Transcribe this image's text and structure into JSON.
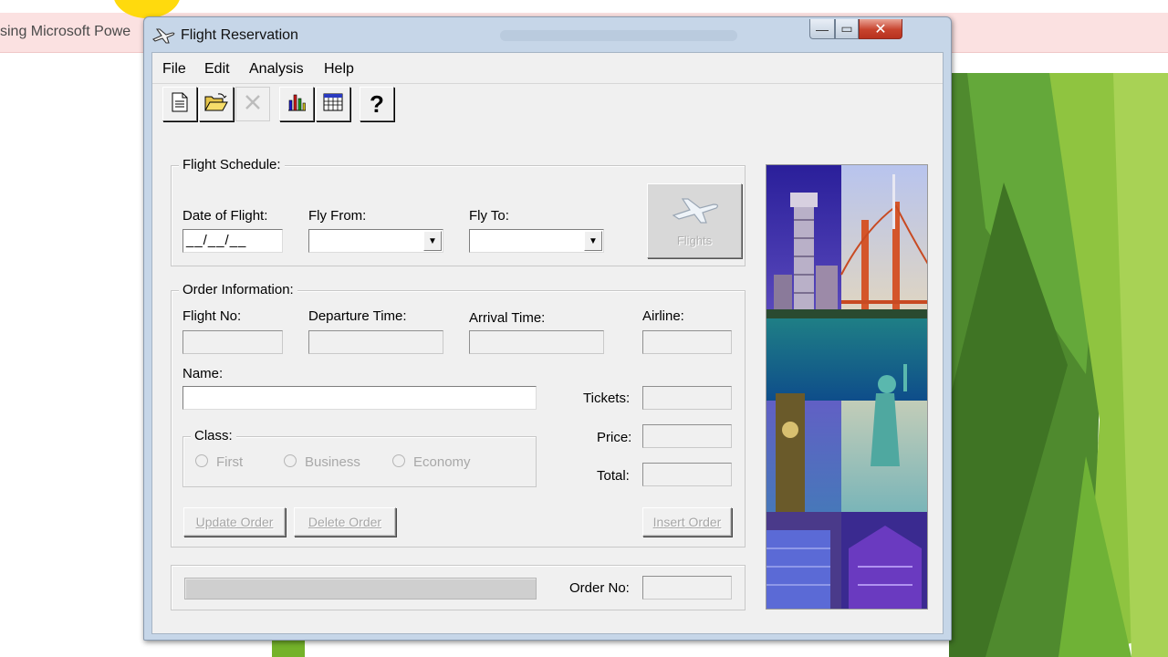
{
  "background": {
    "window_title": "sing Microsoft Powe",
    "colors": {
      "accent_green": "#74b22a",
      "cursor_highlight": "#ffd800",
      "titlebar_pink": "#fbe1e1"
    }
  },
  "window": {
    "title": "Flight Reservation",
    "buttons": {
      "minimize": "—",
      "maximize": "▭",
      "close": "✕"
    }
  },
  "menu": {
    "items": [
      "File",
      "Edit",
      "Analysis",
      "Help"
    ]
  },
  "toolbar": {
    "buttons": [
      {
        "icon": "new-document-icon",
        "enabled": true
      },
      {
        "icon": "open-folder-icon",
        "enabled": true
      },
      {
        "icon": "delete-icon",
        "enabled": false
      },
      {
        "icon": "bar-chart-icon",
        "enabled": true
      },
      {
        "icon": "calendar-icon",
        "enabled": true
      },
      {
        "icon": "help-icon",
        "enabled": true,
        "glyph": "?"
      }
    ]
  },
  "flight_schedule": {
    "title": "Flight Schedule:",
    "date_label": "Date of Flight:",
    "date_value": "__/__/__",
    "from_label": "Fly From:",
    "from_value": "",
    "to_label": "Fly To:",
    "to_value": "",
    "flights_button": "Flights"
  },
  "order_information": {
    "title": "Order Information:",
    "flight_no_label": "Flight No:",
    "departure_label": "Departure Time:",
    "arrival_label": "Arrival Time:",
    "airline_label": "Airline:",
    "name_label": "Name:",
    "name_value": "",
    "tickets_label": "Tickets:",
    "price_label": "Price:",
    "total_label": "Total:",
    "class": {
      "title": "Class:",
      "options": [
        "First",
        "Business",
        "Economy"
      ]
    },
    "buttons": {
      "update": "Update Order",
      "delete": "Delete Order",
      "insert": "Insert Order"
    }
  },
  "footer": {
    "order_no_label": "Order No:",
    "order_no_value": ""
  }
}
